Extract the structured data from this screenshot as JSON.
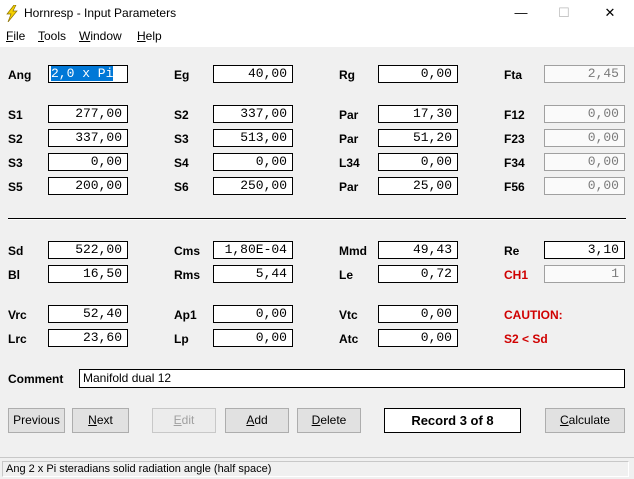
{
  "window": {
    "title": "Hornresp - Input Parameters",
    "minimize": "—",
    "maximize": "☐",
    "close": "✕"
  },
  "menu": [
    {
      "accel": "F",
      "rest": "ile"
    },
    {
      "accel": "T",
      "rest": "ools"
    },
    {
      "accel": "W",
      "rest": "indow"
    },
    {
      "accel": "H",
      "rest": "elp"
    }
  ],
  "params": {
    "ang": {
      "label": "Ang",
      "value": "2,0 x Pi"
    },
    "eg": {
      "label": "Eg",
      "value": "40,00"
    },
    "rg": {
      "label": "Rg",
      "value": "0,00"
    },
    "fta": {
      "label": "Fta",
      "value": "2,45"
    },
    "s1": {
      "label": "S1",
      "value": "277,00"
    },
    "s2a": {
      "label": "S2",
      "value": "337,00"
    },
    "par1": {
      "label": "Par",
      "value": "17,30"
    },
    "f12": {
      "label": "F12",
      "value": "0,00"
    },
    "s2b": {
      "label": "S2",
      "value": "337,00"
    },
    "s3a": {
      "label": "S3",
      "value": "513,00"
    },
    "par2": {
      "label": "Par",
      "value": "51,20"
    },
    "f23": {
      "label": "F23",
      "value": "0,00"
    },
    "s3b": {
      "label": "S3",
      "value": "0,00"
    },
    "s4": {
      "label": "S4",
      "value": "0,00"
    },
    "l34": {
      "label": "L34",
      "value": "0,00"
    },
    "f34": {
      "label": "F34",
      "value": "0,00"
    },
    "s5": {
      "label": "S5",
      "value": "200,00"
    },
    "s6": {
      "label": "S6",
      "value": "250,00"
    },
    "par3": {
      "label": "Par",
      "value": "25,00"
    },
    "f56": {
      "label": "F56",
      "value": "0,00"
    },
    "sd": {
      "label": "Sd",
      "value": "522,00"
    },
    "cms": {
      "label": "Cms",
      "value": "1,80E-04"
    },
    "mmd": {
      "label": "Mmd",
      "value": "49,43"
    },
    "re": {
      "label": "Re",
      "value": "3,10"
    },
    "bl": {
      "label": "Bl",
      "value": "16,50"
    },
    "rms": {
      "label": "Rms",
      "value": "5,44"
    },
    "le": {
      "label": "Le",
      "value": "0,72"
    },
    "ch1": {
      "label": "CH1",
      "value": "1"
    },
    "vrc": {
      "label": "Vrc",
      "value": "52,40"
    },
    "ap1": {
      "label": "Ap1",
      "value": "0,00"
    },
    "vtc": {
      "label": "Vtc",
      "value": "0,00"
    },
    "lrc": {
      "label": "Lrc",
      "value": "23,60"
    },
    "lp": {
      "label": "Lp",
      "value": "0,00"
    },
    "atc": {
      "label": "Atc",
      "value": "0,00"
    }
  },
  "caution": {
    "title": "CAUTION:",
    "message": "S2 < Sd"
  },
  "comment": {
    "label": "Comment",
    "value": "Manifold dual 12"
  },
  "buttons": {
    "previous": {
      "accel": "",
      "before": "Previous",
      "after": ""
    },
    "next": {
      "accel": "N",
      "before": "",
      "after": "ext"
    },
    "edit": {
      "accel": "E",
      "before": "",
      "after": "dit"
    },
    "add": {
      "accel": "A",
      "before": "",
      "after": "dd"
    },
    "delete": {
      "accel": "D",
      "before": "",
      "after": "elete"
    },
    "calculate": {
      "accel": "C",
      "before": "",
      "after": "alculate"
    }
  },
  "record": "Record 3 of 8",
  "status": "Ang   2 x Pi steradians solid radiation angle  (half space)",
  "colors": {
    "caution": "#d00000",
    "selection": "#0078d7",
    "icon": "#f5d000"
  }
}
